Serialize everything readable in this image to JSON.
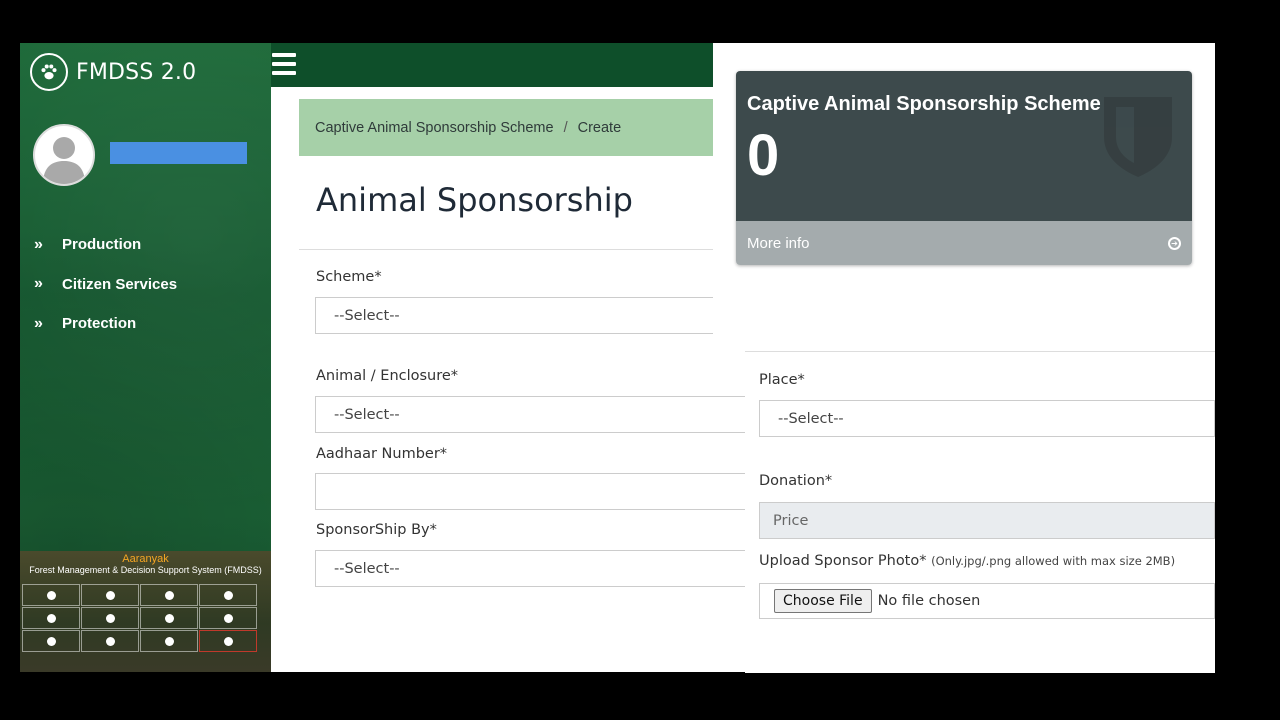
{
  "sidebar": {
    "brand": "FMDSS 2.0",
    "nav_items": [
      {
        "label": "Production"
      },
      {
        "label": "Citizen Services"
      },
      {
        "label": "Protection"
      }
    ],
    "banner": {
      "title": "Aaranyak",
      "subtitle": "Forest Management & Decision Support System (FMDSS)"
    }
  },
  "breadcrumb": {
    "parent": "Captive Animal Sponsorship Scheme",
    "separator": "/",
    "current": "Create"
  },
  "page": {
    "title": "Animal Sponsorship"
  },
  "form": {
    "scheme_label": "Scheme*",
    "scheme_value": "--Select--",
    "animal_label": "Animal / Enclosure*",
    "animal_value": "--Select--",
    "aadhaar_label": "Aadhaar Number*",
    "aadhaar_value": "",
    "sponsorship_label": "SponsorShip By*",
    "sponsorship_value": "--Select--",
    "place_label": "Place*",
    "place_value": "--Select--",
    "donation_label": "Donation*",
    "donation_placeholder": "Price",
    "upload_label": "Upload Sponsor Photo*",
    "upload_note": "(Only.jpg/.png allowed with max size 2MB)",
    "choose_file": "Choose File",
    "file_status": "No file chosen"
  },
  "card": {
    "title": "Captive Animal Sponsorship Scheme",
    "count": "0",
    "more_info": "More info",
    "colors": {
      "top": "#3d4a4c",
      "footer": "#a4abad"
    }
  },
  "colors": {
    "sidebar_green": "#1b6236",
    "topbar_green": "#0e4f2a",
    "breadcrumb_green": "#a6d0a8",
    "username_bar": "#4a90e2"
  }
}
